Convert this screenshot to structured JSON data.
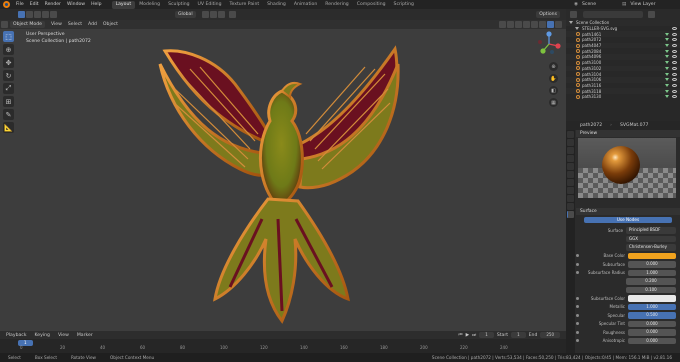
{
  "menu": [
    "File",
    "Edit",
    "Render",
    "Window",
    "Help"
  ],
  "workspaces": [
    "Layout",
    "Modeling",
    "Sculpting",
    "UV Editing",
    "Texture Paint",
    "Shading",
    "Animation",
    "Rendering",
    "Compositing",
    "Scripting"
  ],
  "active_workspace": "Layout",
  "scene": "Scene",
  "view_layer": "View Layer",
  "header": {
    "mode": "Object Mode",
    "menus": [
      "View",
      "Select",
      "Add",
      "Object"
    ],
    "orientation": "Global",
    "options": "Options"
  },
  "viewport": {
    "perspective": "User Perspective",
    "collection": "Scene Collection | path2072"
  },
  "outliner": {
    "root": "Scene Collection",
    "svg": "STELLER-SVG.svg",
    "items": [
      "path1461",
      "path2072",
      "path4047",
      "path2084",
      "path4096",
      "path3100",
      "path3102",
      "path3104",
      "path3106",
      "path3116",
      "path3118",
      "path3130"
    ]
  },
  "properties": {
    "object": "path2072",
    "material": "SVGMat.077",
    "preview": "Preview",
    "surface_title": "Surface",
    "use_nodes": "Use Nodes",
    "rows": [
      {
        "label": "Surface",
        "value": "Principled BSDF",
        "kind": "dark"
      },
      {
        "label": "",
        "value": "GGX",
        "kind": "dark"
      },
      {
        "label": "",
        "value": "Christensen-Burley",
        "kind": "dark"
      },
      {
        "label": "Base Color",
        "value": "",
        "kind": "orange"
      },
      {
        "label": "Subsurface",
        "value": "0.000",
        "kind": "gray"
      },
      {
        "label": "Subsurface Radius",
        "value": "1.000",
        "kind": "gray"
      },
      {
        "label": "",
        "value": "0.200",
        "kind": "gray"
      },
      {
        "label": "",
        "value": "0.100",
        "kind": "gray"
      },
      {
        "label": "Subsurface Color",
        "value": "",
        "kind": "white"
      },
      {
        "label": "Metallic",
        "value": "1.000",
        "kind": "blue"
      },
      {
        "label": "Specular",
        "value": "0.500",
        "kind": "blue"
      },
      {
        "label": "Specular Tint",
        "value": "0.000",
        "kind": "gray"
      },
      {
        "label": "Roughness",
        "value": "0.000",
        "kind": "gray"
      },
      {
        "label": "Anisotropic",
        "value": "0.000",
        "kind": "gray"
      }
    ]
  },
  "timeline": {
    "menus": [
      "Playback",
      "Keying",
      "View",
      "Marker"
    ],
    "current_frame": "1",
    "start_label": "Start",
    "start": "1",
    "end_label": "End",
    "end": "250",
    "ticks": [
      "0",
      "20",
      "40",
      "60",
      "80",
      "100",
      "120",
      "140",
      "160",
      "180",
      "200",
      "220",
      "240"
    ]
  },
  "status": {
    "select": "Select",
    "box_select": "Box Select",
    "rotate": "Rotate View",
    "context": "Object Context Menu",
    "stats": "Scene Collection | path2072 | Verts:53,534 | Faces:50,250 | Tris:83,424 | Objects:0/45 | Mem: 156.1 MiB | v2.81.16"
  },
  "colors": {
    "accent": "#4772b3",
    "base_color": "#f0a21e"
  }
}
